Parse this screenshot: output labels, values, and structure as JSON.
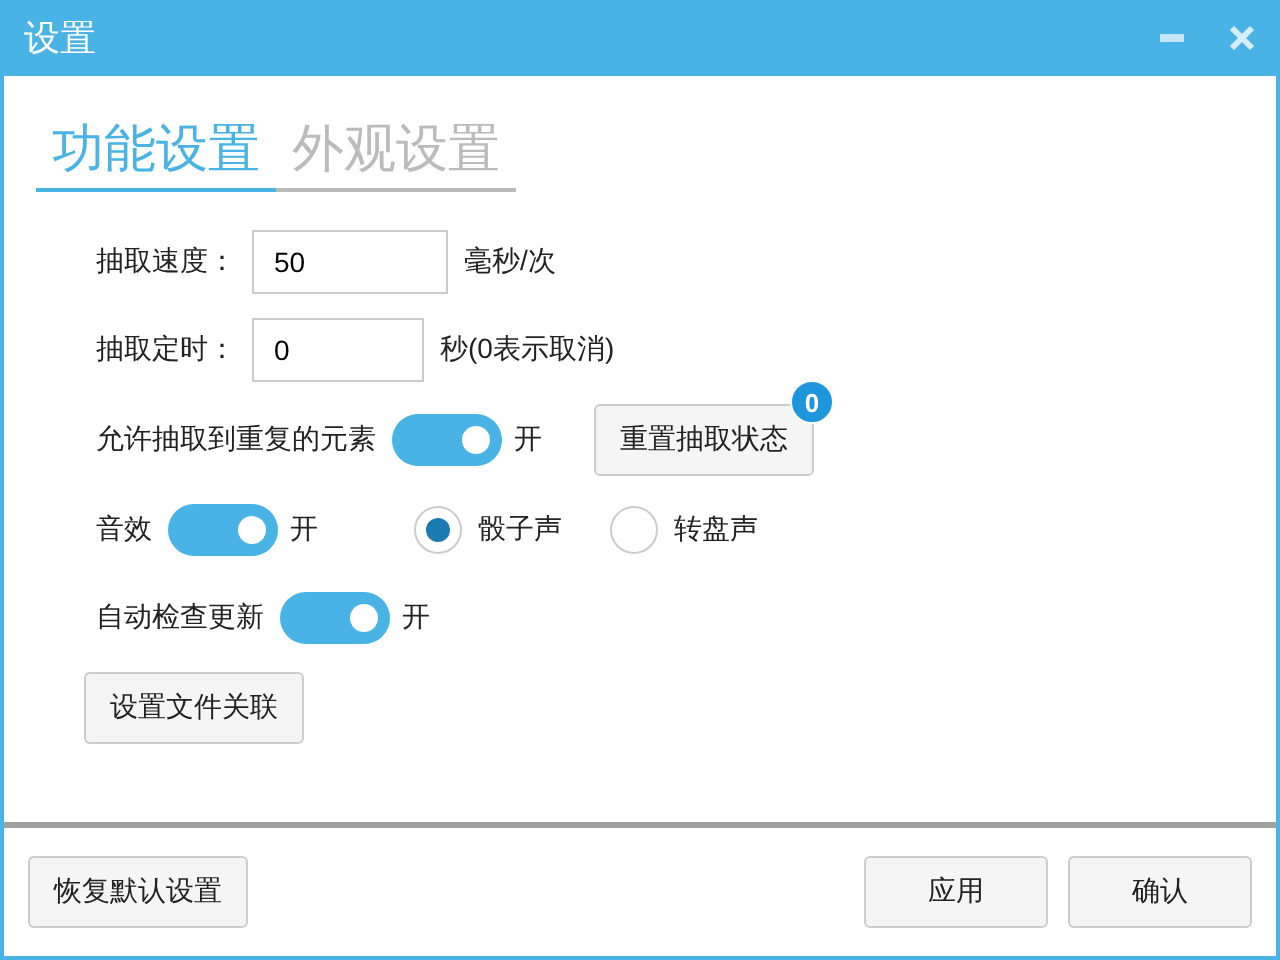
{
  "window": {
    "title": "设置"
  },
  "tabs": [
    {
      "label": "功能设置",
      "selected": true
    },
    {
      "label": "外观设置",
      "selected": false
    }
  ],
  "settings": [
    {
      "kind": "number",
      "label": "抽取速度：",
      "value": "50",
      "unit": "毫秒/次"
    },
    {
      "kind": "number",
      "label": "抽取定时：",
      "value": "0",
      "unit": "秒(0表示取消)"
    },
    {
      "kind": "toggle",
      "label": "允许抽取到重复的元素",
      "on": true,
      "state_label": "开",
      "button": {
        "label": "重置抽取状态",
        "badge": "0"
      }
    },
    {
      "kind": "toggle",
      "label": "音效",
      "on": true,
      "state_label": "开",
      "options": [
        {
          "label": "骰子声",
          "selected": true
        },
        {
          "label": "转盘声",
          "selected": false
        }
      ]
    },
    {
      "kind": "toggle",
      "label": "自动检查更新",
      "on": true,
      "state_label": "开"
    },
    {
      "kind": "button",
      "label": "设置文件关联"
    }
  ],
  "footer": {
    "left_buttons": [
      "恢复默认设置"
    ],
    "right_buttons": [
      "应用",
      "确认"
    ]
  }
}
